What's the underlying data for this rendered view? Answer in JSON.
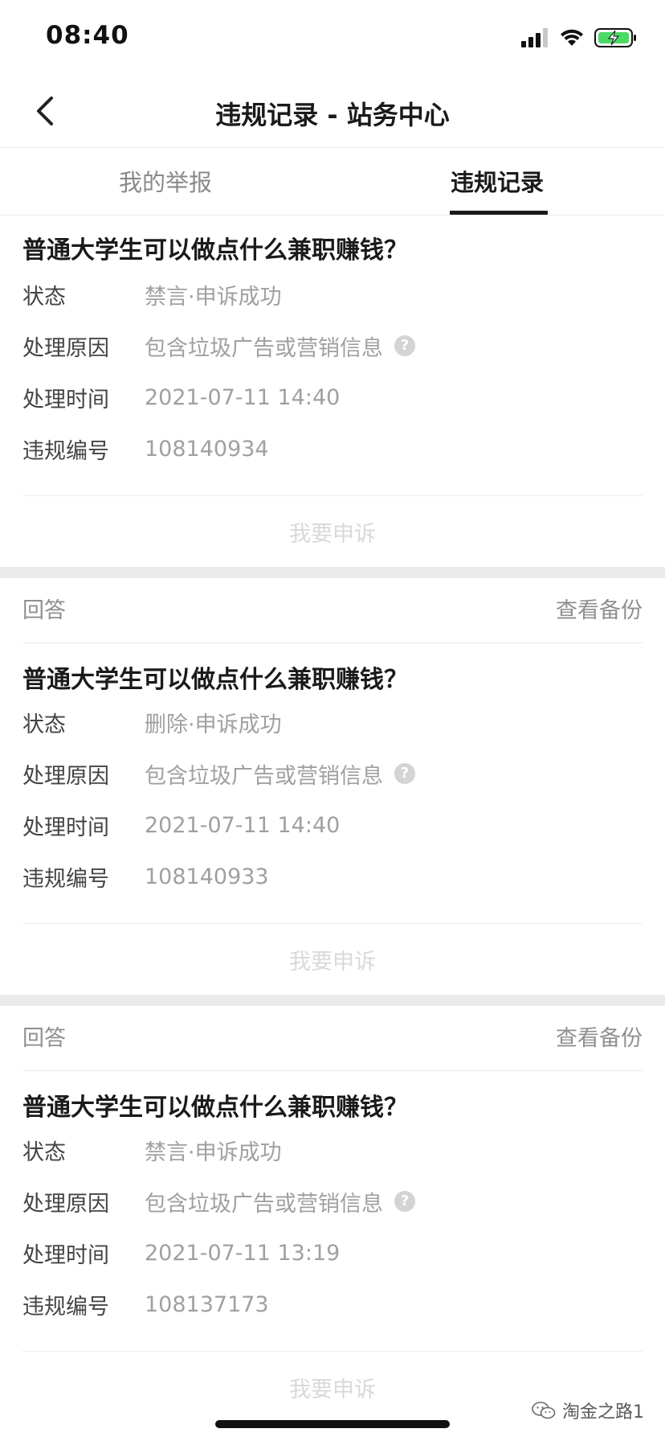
{
  "status_bar": {
    "time": "08:40",
    "icons": [
      "cellular-signal-icon",
      "wifi-icon",
      "battery-charging-icon"
    ]
  },
  "nav": {
    "title": "违规记录 - 站务中心",
    "back_icon": "chevron-left-icon"
  },
  "tabs": [
    {
      "label": "我的举报",
      "active": false
    },
    {
      "label": "违规记录",
      "active": true
    }
  ],
  "labels": {
    "status": "状态",
    "reason": "处理原因",
    "time": "处理时间",
    "number": "违规编号",
    "appeal": "我要申诉",
    "view_backup": "查看备份"
  },
  "records": [
    {
      "type": "",
      "title": "普通大学生可以做点什么兼职赚钱？",
      "status": "禁言·申诉成功",
      "reason": "包含垃圾广告或营销信息",
      "time": "2021-07-11 14:40",
      "number": "108140934"
    },
    {
      "type": "回答",
      "title": "普通大学生可以做点什么兼职赚钱？",
      "status": "删除·申诉成功",
      "reason": "包含垃圾广告或营销信息",
      "time": "2021-07-11 14:40",
      "number": "108140933"
    },
    {
      "type": "回答",
      "title": "普通大学生可以做点什么兼职赚钱？",
      "status": "禁言·申诉成功",
      "reason": "包含垃圾广告或营销信息",
      "time": "2021-07-11 13:19",
      "number": "108137173"
    }
  ],
  "watermark": "淘金之路1",
  "colors": {
    "text_primary": "#1a1a1a",
    "text_muted": "#a0a0a0",
    "appeal_disabled": "#d9d9d9",
    "separator": "#ebebeb",
    "battery_green": "#4cd964"
  }
}
